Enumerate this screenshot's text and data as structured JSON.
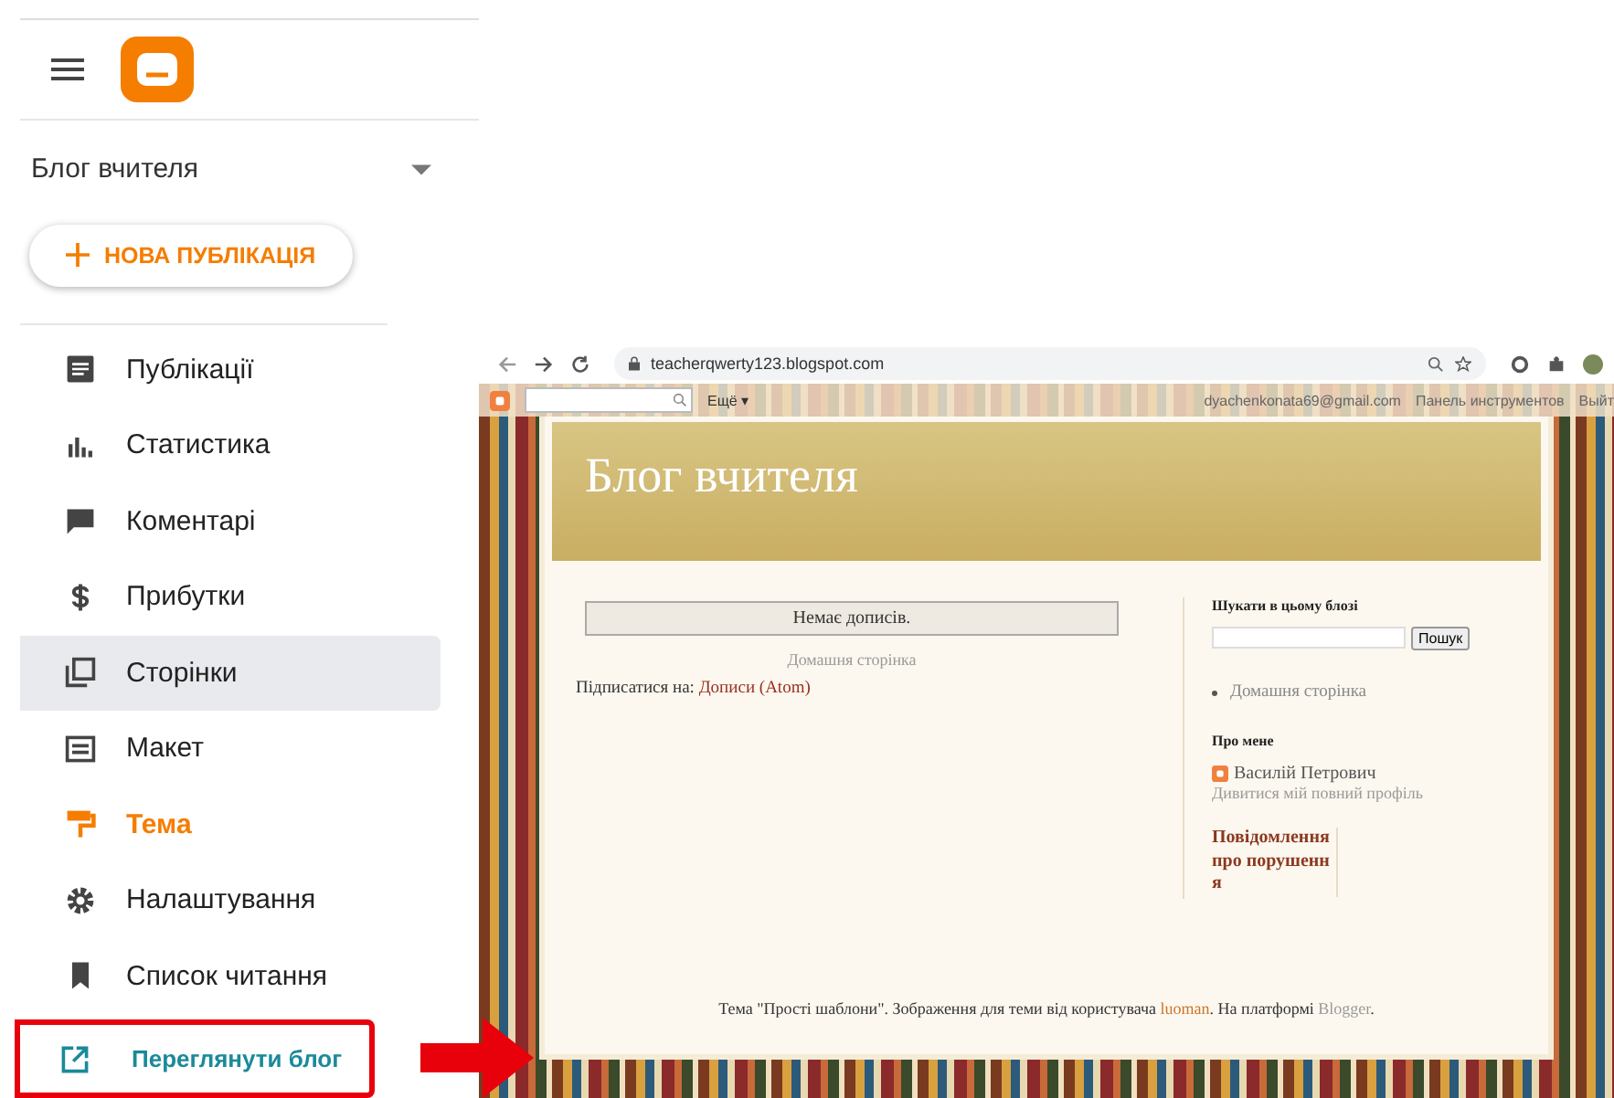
{
  "sidebar": {
    "blog_name": "Блог вчителя",
    "new_post_button": "НОВА ПУБЛІКАЦІЯ",
    "items": [
      {
        "kind": "posts",
        "label": "Публікації",
        "selected": false,
        "highlighted": false
      },
      {
        "kind": "stats",
        "label": "Статистика",
        "selected": false,
        "highlighted": false
      },
      {
        "kind": "comments",
        "label": "Коментарі",
        "selected": false,
        "highlighted": false
      },
      {
        "kind": "earnings",
        "label": "Прибутки",
        "selected": false,
        "highlighted": false
      },
      {
        "kind": "pages",
        "label": "Сторінки",
        "selected": true,
        "highlighted": false
      },
      {
        "kind": "layout",
        "label": "Макет",
        "selected": false,
        "highlighted": false
      },
      {
        "kind": "theme",
        "label": "Тема",
        "selected": false,
        "highlighted": true
      },
      {
        "kind": "settings",
        "label": "Налаштування",
        "selected": false,
        "highlighted": false
      },
      {
        "kind": "reading",
        "label": "Список читання",
        "selected": false,
        "highlighted": false
      },
      {
        "kind": "view",
        "label": "Переглянути блог",
        "selected": false,
        "highlighted": false
      }
    ]
  },
  "browser": {
    "url": "teacherqwerty123.blogspot.com",
    "navbar": {
      "more": "Ещё ▾",
      "email": "dyachenkonata69@gmail.com",
      "dashboard": "Панель инструментов",
      "sign_out": "Выйт"
    }
  },
  "blog": {
    "title": "Блог вчителя",
    "no_posts": "Немає дописів.",
    "home_link": "Домашня сторінка",
    "subscribe_label": "Підписатися на:",
    "subscribe_link": "Дописи (Atom)",
    "search_title": "Шукати в цьому блозі",
    "search_button": "Пошук",
    "pages": [
      "Домашня сторінка"
    ],
    "about_title": "Про мене",
    "author": "Василій Петрович",
    "profile_link": "Дивитися мій повний профіль",
    "report_link": "Повідомлення про порушення",
    "footer": {
      "before": "Тема \"Прості шаблони\". Зображення для теми від користувача",
      "author_link": "luoman",
      "middle": ". На платформі",
      "platform_link": "Blogger",
      "after": "."
    }
  }
}
